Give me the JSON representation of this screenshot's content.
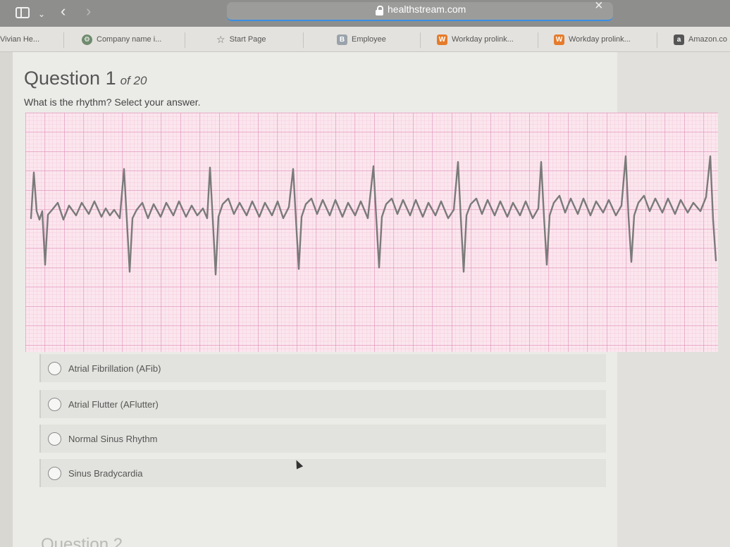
{
  "browser": {
    "url": "healthstream.com",
    "icons": [
      "sidebar-icon",
      "chevron-down-icon",
      "back-icon",
      "forward-icon",
      "lock-icon",
      "close-icon"
    ]
  },
  "bookmarks": [
    {
      "label": "Vivian He...",
      "icon": "none"
    },
    {
      "label": "Company name i...",
      "icon": "gear-icon"
    },
    {
      "label": "Start Page",
      "icon": "star-icon"
    },
    {
      "label": "Employee",
      "icon": "b-icon"
    },
    {
      "label": "Workday prolink...",
      "icon": "w-icon"
    },
    {
      "label": "Workday prolink...",
      "icon": "w-icon"
    },
    {
      "label": "Amazon.co",
      "icon": "a-icon"
    }
  ],
  "question": {
    "title": "Question 1",
    "of_label": "of 20",
    "prompt": "What is the rhythm? Select your answer."
  },
  "options": [
    {
      "label": "Atrial Fibrillation (AFib)",
      "selected": false
    },
    {
      "label": "Atrial Flutter (AFlutter)",
      "selected": false
    },
    {
      "label": "Normal Sinus Rhythm",
      "selected": false
    },
    {
      "label": "Sinus Bradycardia",
      "selected": false
    }
  ],
  "next_question_partial": "Question 2",
  "colors": {
    "ecg_grid": "#e49ac0",
    "ecg_background": "#fbe6ee",
    "ecg_trace": "#777777",
    "link_accent": "#3a8ee6"
  }
}
